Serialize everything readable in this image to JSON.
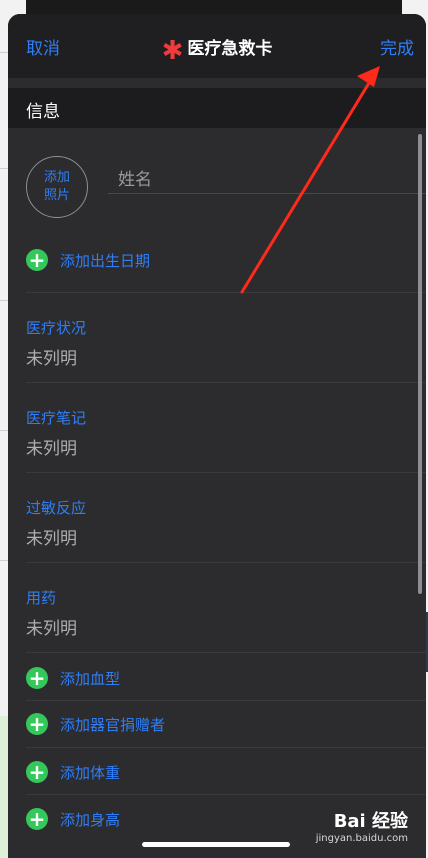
{
  "nav": {
    "cancel": "取消",
    "title": "医疗急救卡",
    "done": "完成"
  },
  "section": {
    "title": "信息"
  },
  "photo": {
    "line1": "添加",
    "line2": "照片"
  },
  "name_field": {
    "placeholder": "姓名",
    "value": ""
  },
  "add_birthdate": "添加出生日期",
  "fields": [
    {
      "label": "医疗状况",
      "value": "未列明"
    },
    {
      "label": "医疗笔记",
      "value": "未列明"
    },
    {
      "label": "过敏反应",
      "value": "未列明"
    },
    {
      "label": "用药",
      "value": "未列明"
    }
  ],
  "add_rows": [
    {
      "label": "添加血型"
    },
    {
      "label": "添加器官捐赠者"
    },
    {
      "label": "添加体重"
    },
    {
      "label": "添加身高"
    }
  ],
  "watermark": {
    "logo": "Bai 经验",
    "url": "jingyan.baidu.com"
  },
  "colors": {
    "accent": "#2f7ef7",
    "add": "#34c759",
    "emergency": "#ef3b3b",
    "annotation_arrow": "#ff2a1a"
  },
  "icons": {
    "emergency": "asterisk-icon",
    "add": "plus-circle-icon"
  }
}
